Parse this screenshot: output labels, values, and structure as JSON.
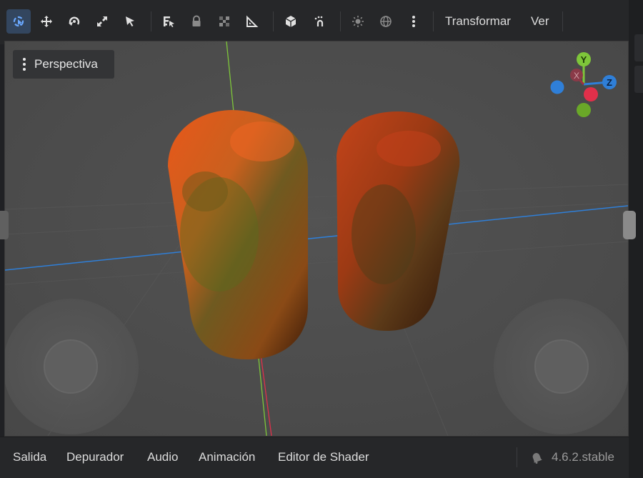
{
  "toolbar": {
    "tools": [
      {
        "name": "select-mode-icon",
        "active": true
      },
      {
        "name": "move-icon",
        "active": false
      },
      {
        "name": "rotate-icon",
        "active": false
      },
      {
        "name": "scale-icon",
        "active": false
      },
      {
        "name": "pointer-icon",
        "active": false
      },
      {
        "name": "list-select-icon",
        "active": false
      },
      {
        "name": "lock-icon",
        "active": false
      },
      {
        "name": "grid-snap-icon",
        "active": false
      },
      {
        "name": "ruler-icon",
        "active": false
      },
      {
        "name": "cube-icon",
        "active": false
      },
      {
        "name": "snap-magnet-icon",
        "active": false
      },
      {
        "name": "sun-icon",
        "active": false
      },
      {
        "name": "globe-icon",
        "active": false
      },
      {
        "name": "more-vertical-icon",
        "active": false
      }
    ],
    "menu_transform": "Transformar",
    "menu_view": "Ver"
  },
  "viewport": {
    "perspective_label": "Perspectiva",
    "gizmo": {
      "y_label": "Y",
      "x_label": "X",
      "z_label": "Z"
    },
    "colors": {
      "background": "#4a4a4a",
      "x_axis": "#e0304a",
      "y_axis": "#7ec63a",
      "z_axis": "#2f7fd8"
    }
  },
  "bottom_panel": {
    "tabs": [
      "Salida",
      "Depurador",
      "Audio",
      "Animación",
      "Editor de Shader"
    ],
    "version": "4.6.2.stable"
  },
  "colors": {
    "accent": "#4a8fe0",
    "toolbar_bg": "#262729"
  }
}
